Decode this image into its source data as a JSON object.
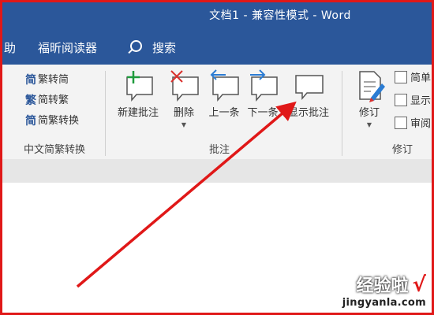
{
  "window": {
    "title": "文档1 - 兼容性模式 - Word"
  },
  "menu": {
    "items": [
      {
        "label": "助"
      },
      {
        "label": "福昕阅读器"
      }
    ],
    "search_label": "搜索"
  },
  "chinese_conversion": {
    "buttons": [
      {
        "glyph": "简",
        "label": "繁转简"
      },
      {
        "glyph": "繁",
        "label": "简转繁"
      },
      {
        "glyph": "简",
        "label": "简繁转换"
      }
    ],
    "group_label": "中文简繁转换"
  },
  "comments": {
    "buttons": [
      {
        "label": "新建批注",
        "icon": "new-comment-icon"
      },
      {
        "label": "删除",
        "icon": "delete-comment-icon"
      },
      {
        "label": "上一条",
        "icon": "previous-comment-icon"
      },
      {
        "label": "下一条",
        "icon": "next-comment-icon"
      },
      {
        "label": "显示批注",
        "icon": "show-comments-icon"
      }
    ],
    "group_label": "批注"
  },
  "tracking": {
    "track_changes_label": "修订",
    "items": [
      {
        "label": "简单"
      },
      {
        "label": "显示"
      },
      {
        "label": "审阅"
      }
    ],
    "group_label": "修订"
  },
  "watermark": {
    "main": "经验啦",
    "check": "√",
    "url": "jingyanla.com"
  },
  "colors": {
    "title_bar": "#2b579a",
    "ribbon": "#f3f3f3",
    "annotation": "#e01818",
    "icon_green": "#1e9b3c",
    "icon_red": "#d9302c",
    "icon_blue": "#2b7cd3"
  }
}
